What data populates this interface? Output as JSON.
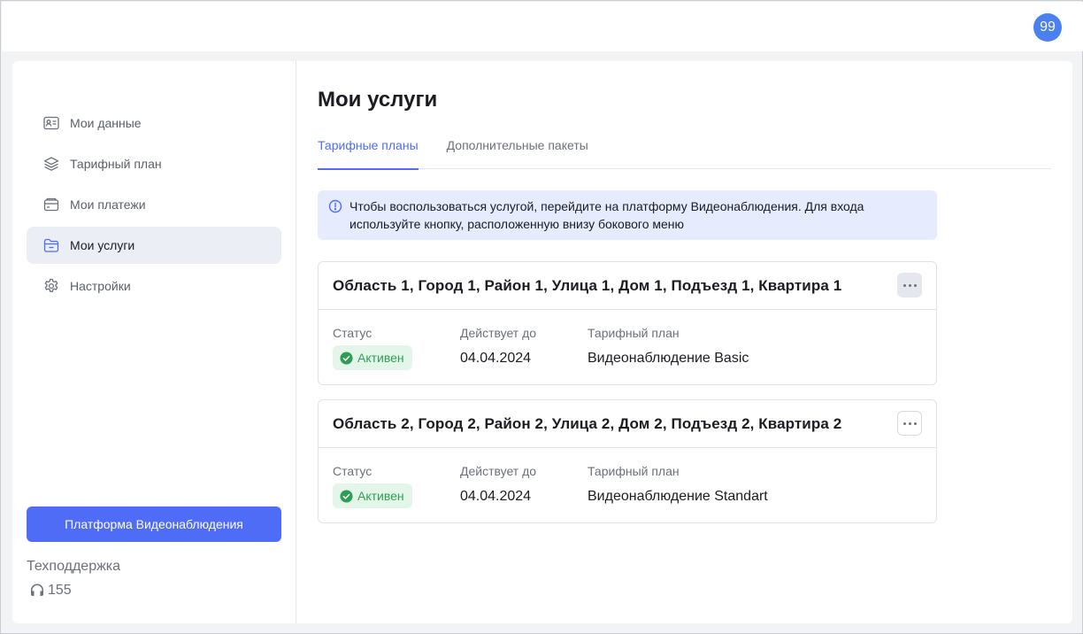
{
  "header": {
    "avatar_initials": "99"
  },
  "sidebar": {
    "items": [
      {
        "label": "Мои данные",
        "icon": "id-card-icon",
        "active": false
      },
      {
        "label": "Тарифный план",
        "icon": "layers-icon",
        "active": false
      },
      {
        "label": "Мои платежи",
        "icon": "wallet-icon",
        "active": false
      },
      {
        "label": "Мои услуги",
        "icon": "folder-icon",
        "active": true
      },
      {
        "label": "Настройки",
        "icon": "gear-icon",
        "active": false
      }
    ],
    "platform_button": "Платформа Видеонаблюдения",
    "support_title": "Техподдержка",
    "support_phone": "155"
  },
  "main": {
    "title": "Мои услуги",
    "tabs": [
      {
        "label": "Тарифные планы",
        "active": true
      },
      {
        "label": "Дополнительные пакеты",
        "active": false
      }
    ],
    "info_text": "Чтобы воспользоваться услугой, перейдите на платформу Видеонаблюдения. Для входа используйте кнопку, расположенную внизу бокового меню",
    "services": [
      {
        "address": "Область 1, Город 1, Район 1, Улица 1, Дом 1, Подъезд 1, Квартира 1",
        "status_label": "Статус",
        "status": "Активен",
        "valid_label": "Действует до",
        "valid_until": "04.04.2024",
        "plan_label": "Тарифный план",
        "plan": "Видеонаблюдение Basic"
      },
      {
        "address": "Область 2, Город 2, Район 2, Улица 2, Дом 2, Подъезд 2, Квартира 2",
        "status_label": "Статус",
        "status": "Активен",
        "valid_label": "Действует до",
        "valid_until": "04.04.2024",
        "plan_label": "Тарифный план",
        "plan": "Видеонаблюдение Standart"
      }
    ]
  },
  "colors": {
    "accent": "#4f6cf7",
    "avatar": "#4a80f0",
    "info_bg": "#e6ecfd",
    "status_bg": "#e4f6ea",
    "status_text": "#2e9e55"
  }
}
